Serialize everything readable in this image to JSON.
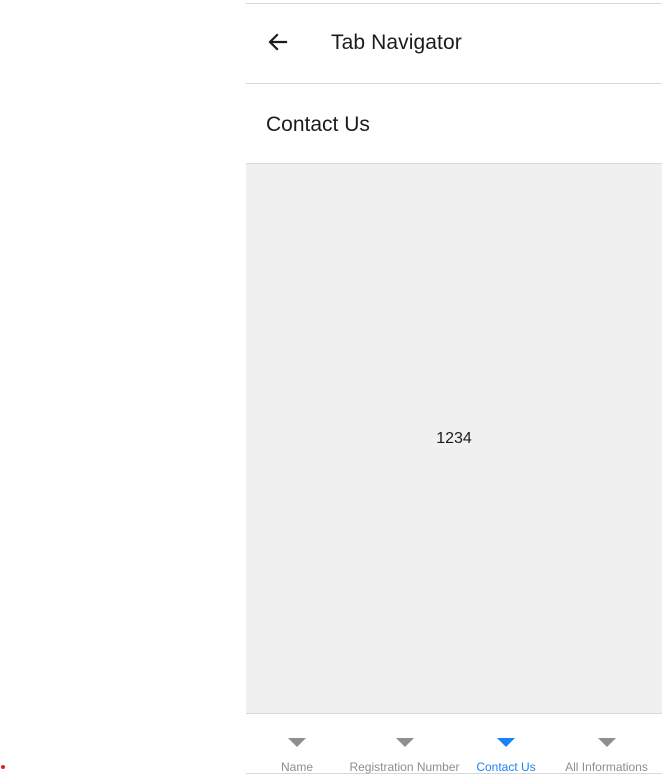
{
  "header": {
    "title": "Tab Navigator",
    "back_icon": "arrow-left-icon"
  },
  "screen": {
    "title": "Contact Us",
    "value": "1234"
  },
  "tabs": [
    {
      "label": "Name",
      "icon": "triangle-down-icon",
      "active": false
    },
    {
      "label": "Registration Number",
      "icon": "triangle-down-icon",
      "active": false
    },
    {
      "label": "Contact Us",
      "icon": "triangle-down-icon",
      "active": true
    },
    {
      "label": "All Informations",
      "icon": "triangle-down-icon",
      "active": false
    }
  ],
  "colors": {
    "active_tab": "#1a82f7",
    "inactive_tab": "#8e8e93",
    "content_background": "#f0f0f0"
  }
}
